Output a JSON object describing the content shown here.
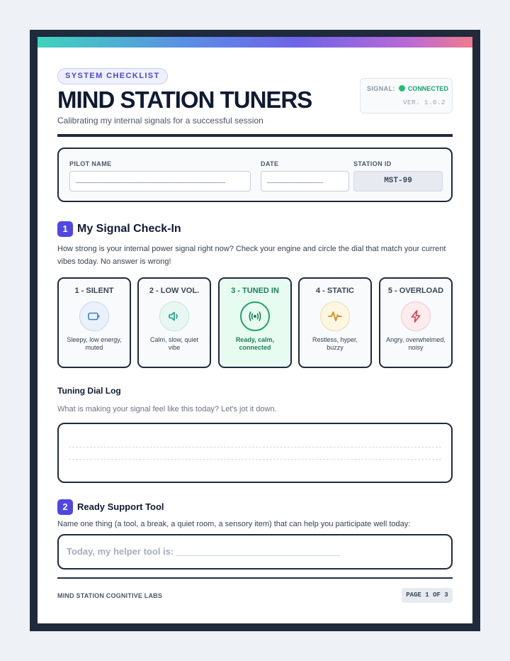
{
  "header": {
    "tag": "SYSTEM CHECKLIST",
    "title": "MIND STATION TUNERS",
    "subtitle": "Calibrating my internal signals for a successful session",
    "signal_label": "SIGNAL:",
    "signal_status": "CONNECTED",
    "version": "VER. 1.0.2"
  },
  "info": {
    "pilot_label": "PILOT NAME",
    "pilot_value": "________________________________",
    "date_label": "DATE",
    "date_value": "____________",
    "station_label": "STATION ID",
    "station_value": "MST-99"
  },
  "section1": {
    "number": "1",
    "title": "My Signal Check-In",
    "instructions": "How strong is your internal power signal right now? Check your engine and circle the dial that match your current vibes today. No answer is wrong!",
    "cards": [
      {
        "title": "1 - SILENT",
        "desc": "Sleepy, low energy, muted",
        "icon": "battery-icon"
      },
      {
        "title": "2 - LOW VOL.",
        "desc": "Calm, slow, quiet vibe",
        "icon": "speaker-icon"
      },
      {
        "title": "3 - TUNED IN",
        "desc": "Ready, calm, connected",
        "icon": "broadcast-icon"
      },
      {
        "title": "4 - STATIC",
        "desc": "Restless, hyper, buzzy",
        "icon": "pulse-icon"
      },
      {
        "title": "5 - OVERLOAD",
        "desc": "Angry, overwhelmed, noisy",
        "icon": "lightning-icon"
      }
    ],
    "log_title": "Tuning Dial Log",
    "log_prompt": "What is making your signal feel like this today? Let's jot it down."
  },
  "section2": {
    "number": "2",
    "title": "Ready Support Tool",
    "instructions": "Name one thing (a tool, a break, a quiet room, a sensory item) that can help you participate well today:",
    "prompt": "Today, my helper tool is: ________________________________"
  },
  "footer": {
    "org": "MIND STATION COGNITIVE LABS",
    "page": "PAGE 1 OF 3"
  },
  "colors": {
    "accent": "#4f46e5",
    "dark": "#1f2a3c",
    "connected": "#1fbf7a",
    "selected_bg": "#e8fbf1"
  }
}
